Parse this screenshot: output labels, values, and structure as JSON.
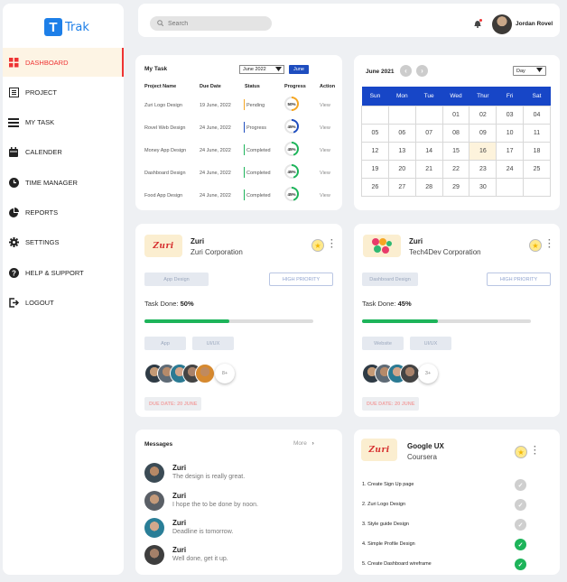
{
  "brand": {
    "logo_letter": "T",
    "name": "Trak",
    "color": "#1d7fe8"
  },
  "sidebar": {
    "items": [
      {
        "label": "DASHBOARD",
        "icon": "grid-icon",
        "active": true
      },
      {
        "label": "PROJECT",
        "icon": "list-icon"
      },
      {
        "label": "MY TASK",
        "icon": "menu-icon"
      },
      {
        "label": "CALENDER",
        "icon": "calendar-icon"
      },
      {
        "label": "TIME MANAGER",
        "icon": "clock-icon"
      },
      {
        "label": "REPORTS",
        "icon": "pie-chart-icon"
      },
      {
        "label": "SETTINGS",
        "icon": "gear-icon"
      },
      {
        "label": "HELP & SUPPORT",
        "icon": "help-icon"
      },
      {
        "label": "LOGOUT",
        "icon": "logout-icon"
      }
    ]
  },
  "topbar": {
    "search_placeholder": "Search",
    "user_name": "Jordan Rovel"
  },
  "my_task": {
    "title": "My Task",
    "month_select": "June 2022",
    "month_button": "June",
    "columns": [
      "Project Name",
      "Due Date",
      "Status",
      "Progress",
      "Action"
    ],
    "rows": [
      {
        "name": "Zuri Logo Design",
        "due": "19 June, 2022",
        "status": "Pending",
        "status_color": "#f5a623",
        "progress": "50%",
        "progress_value": 50,
        "progress_color": "#f5a623",
        "action": "View"
      },
      {
        "name": "Rovel Web Design",
        "due": "24 June, 2022",
        "status": "Progress",
        "status_color": "#1e4dbf",
        "progress": "45%",
        "progress_value": 45,
        "progress_color": "#1e4dbf",
        "action": "View"
      },
      {
        "name": "Money App Design",
        "due": "24 June, 2022",
        "status": "Completed",
        "status_color": "#1db45a",
        "progress": "45%",
        "progress_value": 45,
        "progress_color": "#1db45a",
        "action": "View"
      },
      {
        "name": "Dashboard Design",
        "due": "24 June, 2022",
        "status": "Completed",
        "status_color": "#1db45a",
        "progress": "45%",
        "progress_value": 45,
        "progress_color": "#1db45a",
        "action": "View"
      },
      {
        "name": "Food App Design",
        "due": "24 June, 2022",
        "status": "Completed",
        "status_color": "#1db45a",
        "progress": "45%",
        "progress_value": 45,
        "progress_color": "#1db45a",
        "action": "View"
      }
    ]
  },
  "calendar": {
    "month": "June 2021",
    "view": "Day",
    "days": [
      "Sun",
      "Mon",
      "Tue",
      "Wed",
      "Thur",
      "Fri",
      "Sat"
    ],
    "weeks": [
      [
        "",
        "",
        "",
        "01",
        "02",
        "03",
        "04"
      ],
      [
        "05",
        "06",
        "07",
        "08",
        "09",
        "10",
        "11"
      ],
      [
        "12",
        "13",
        "14",
        "15",
        "16",
        "17",
        "18"
      ],
      [
        "19",
        "20",
        "21",
        "22",
        "23",
        "24",
        "25"
      ],
      [
        "26",
        "27",
        "28",
        "29",
        "30",
        "",
        ""
      ]
    ],
    "highlighted": "16"
  },
  "projects": [
    {
      "logo": "Zuri",
      "name": "Zuri",
      "company": "Zuri Corporation",
      "tag": "App Design",
      "priority": "HIGH PRIORITY",
      "task_done_label": "Task Done:",
      "task_done": "50%",
      "task_done_value": 50,
      "tags": [
        "App",
        "UI/UX"
      ],
      "more_members": "8+",
      "due": "DUE DATE: 20 JUNE"
    },
    {
      "logo": "Tech4Dev",
      "name": "Zuri",
      "company": "Tech4Dev Corporation",
      "tag": "Dashboard Design",
      "priority": "HIGH PRIORITY",
      "task_done_label": "Task Done:",
      "task_done": "45%",
      "task_done_value": 45,
      "tags": [
        "Website",
        "UI/UX"
      ],
      "more_members": "3+",
      "due": "DUE DATE: 20 JUNE"
    }
  ],
  "messages": {
    "title": "Messages",
    "more": "More",
    "items": [
      {
        "name": "Zuri",
        "text": "The design is really great."
      },
      {
        "name": "Zuri",
        "text": "I hope the to be done by noon."
      },
      {
        "name": "Zuri",
        "text": "Deadline is tomorrow."
      },
      {
        "name": "Zuri",
        "text": "Well done, get it up."
      }
    ]
  },
  "course": {
    "logo": "Zuri",
    "name": "Google UX",
    "provider": "Coursera",
    "steps": [
      {
        "label": "1.  Create Sign Up page",
        "done": false
      },
      {
        "label": "2.  Zuri Logo Design",
        "done": false
      },
      {
        "label": "3.  Style guide Design",
        "done": false
      },
      {
        "label": "4.  Simple Profile Design",
        "done": true
      },
      {
        "label": "5.  Create Dashboard wireframe",
        "done": true
      }
    ]
  },
  "colors": {
    "accent": "#1e4dbf",
    "active_nav": "#e33333",
    "success": "#1db45a",
    "warning": "#f5a623"
  }
}
